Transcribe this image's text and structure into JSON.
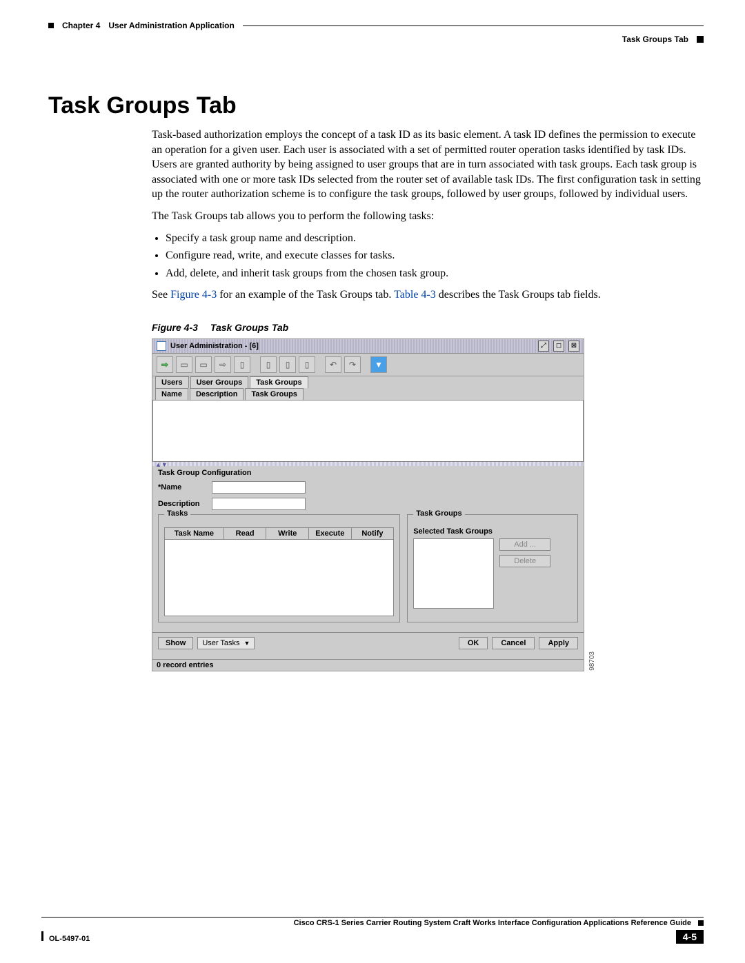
{
  "header": {
    "chapter_label": "Chapter 4",
    "chapter_title": "User Administration Application",
    "section_right": "Task Groups Tab"
  },
  "section": {
    "title": "Task Groups Tab",
    "para1": "Task-based authorization employs the concept of a task ID as its basic element. A task ID defines the permission to execute an operation for a given user. Each user is associated with a set of permitted router operation tasks identified by task IDs. Users are granted authority by being assigned to user groups that are in turn associated with task groups. Each task group is associated with one or more task IDs selected from the router set of available task IDs. The first configuration task in setting up the router authorization scheme is to configure the task groups, followed by user groups, followed by individual users.",
    "para2": "The Task Groups tab allows you to perform the following tasks:",
    "bullets": [
      "Specify a task group name and description.",
      "Configure read, write, and execute classes for tasks.",
      "Add, delete, and inherit task groups from the chosen task group."
    ],
    "see_pre": "See ",
    "see_fig": "Figure 4-3",
    "see_mid": " for an example of the Task Groups tab. ",
    "see_tbl": "Table 4-3",
    "see_post": " describes the Task Groups tab fields.",
    "fig_caption_num": "Figure 4-3",
    "fig_caption_title": "Task Groups Tab"
  },
  "app": {
    "title": "User Administration - [6]",
    "win_controls": {
      "min": "⤢",
      "max": "◻",
      "close": "⊠"
    },
    "toolbar_icons": [
      "⇨",
      "▭",
      "▭",
      "⇨",
      "▯",
      "",
      "▯",
      "▯",
      "▯",
      "",
      "↶",
      "↷",
      "",
      "▼"
    ],
    "tabs1": [
      "Users",
      "User Groups",
      "Task Groups"
    ],
    "tabs2": [
      "Name",
      "Description",
      "Task Groups"
    ],
    "cfg_header": "Task Group Configuration",
    "name_label": "*Name",
    "desc_label": "Description",
    "tasks_legend": "Tasks",
    "task_cols": [
      "Task Name",
      "Read",
      "Write",
      "Execute",
      "Notify"
    ],
    "tg_legend": "Task Groups",
    "tg_sel_label": "Selected Task Groups",
    "add_btn": "Add ...",
    "del_btn": "Delete",
    "show_btn": "Show",
    "show_dd": "User Tasks",
    "ok": "OK",
    "cancel": "Cancel",
    "apply": "Apply",
    "status": "0 record entries",
    "img_num": "98703"
  },
  "footer": {
    "book": "Cisco CRS-1 Series Carrier Routing System Craft Works Interface Configuration Applications Reference Guide",
    "doc_id": "OL-5497-01",
    "page": "4-5"
  }
}
